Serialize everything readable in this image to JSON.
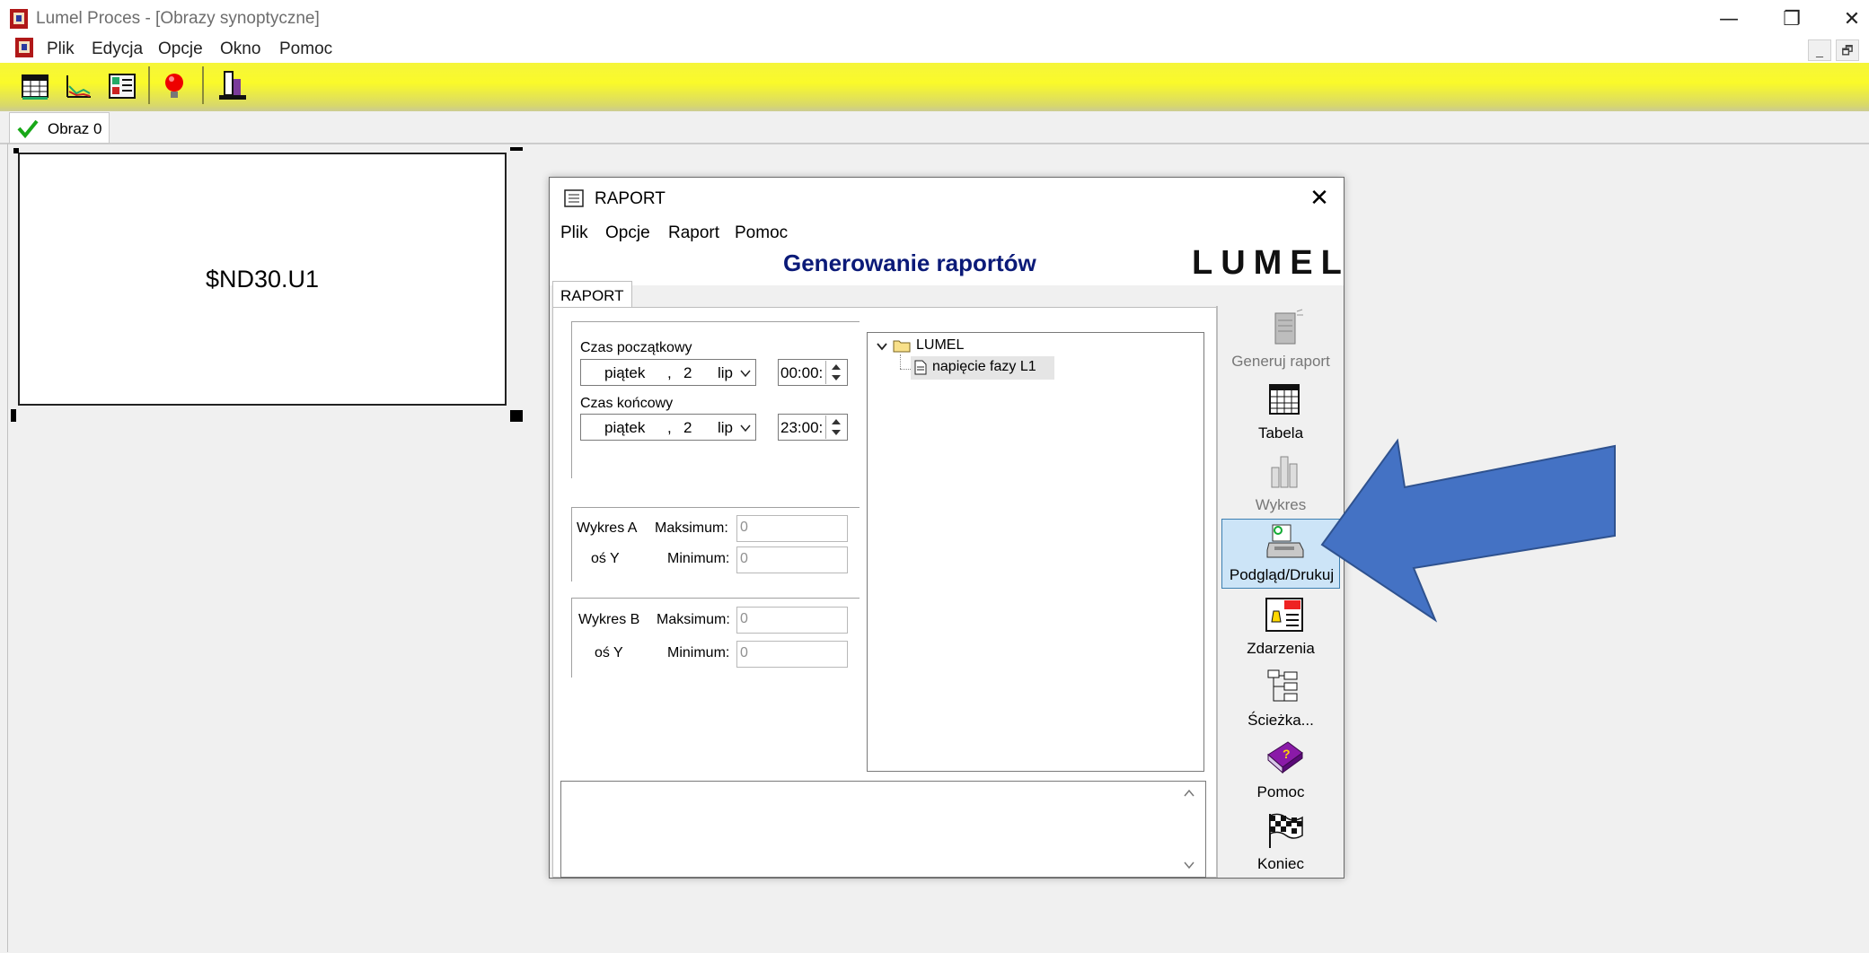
{
  "window": {
    "title": "Lumel Proces - [Obrazy synoptyczne]",
    "controls": [
      "—",
      "❐",
      "✕"
    ],
    "mdi_controls": [
      "_",
      "🗗"
    ]
  },
  "menu": {
    "items": [
      "Plik",
      "Edycja",
      "Opcje",
      "Okno",
      "Pomoc"
    ]
  },
  "toolbar": {
    "buttons": [
      "table-icon",
      "chart-icon",
      "io-icon",
      "alarm-bulb-icon",
      "report-icon"
    ]
  },
  "tabs": {
    "active": "Obraz 0"
  },
  "canvas": {
    "element_text": "$ND30.U1"
  },
  "raport": {
    "title": "RAPORT",
    "close": "✕",
    "menu": [
      "Plik",
      "Opcje",
      "Raport",
      "Pomoc"
    ],
    "header": "Generowanie raportów",
    "logo": "LUMEL",
    "tab": "RAPORT",
    "start": {
      "label": "Czas początkowy",
      "day": "piątek",
      "sep": ",",
      "date": "2",
      "month": "lip",
      "time": "00:00:"
    },
    "end": {
      "label": "Czas końcowy",
      "day": "piątek",
      "sep": ",",
      "date": "2",
      "month": "lip",
      "time": "23:00:"
    },
    "chartA": {
      "name": "Wykres A",
      "axis": "oś Y",
      "max_label": "Maksimum:",
      "min_label": "Minimum:",
      "max": "0",
      "min": "0"
    },
    "chartB": {
      "name": "Wykres B",
      "axis": "oś Y",
      "max_label": "Maksimum:",
      "min_label": "Minimum:",
      "max": "0",
      "min": "0"
    },
    "tree": {
      "root": "LUMEL",
      "child": "napięcie fazy L1"
    },
    "sidebar": [
      "Generuj raport",
      "Tabela",
      "Wykres",
      "Podgląd/Drukuj",
      "Zdarzenia",
      "Ścieżka...",
      "Pomoc",
      "Koniec"
    ]
  },
  "annotation": {
    "arrow_color": "#4472c4"
  }
}
